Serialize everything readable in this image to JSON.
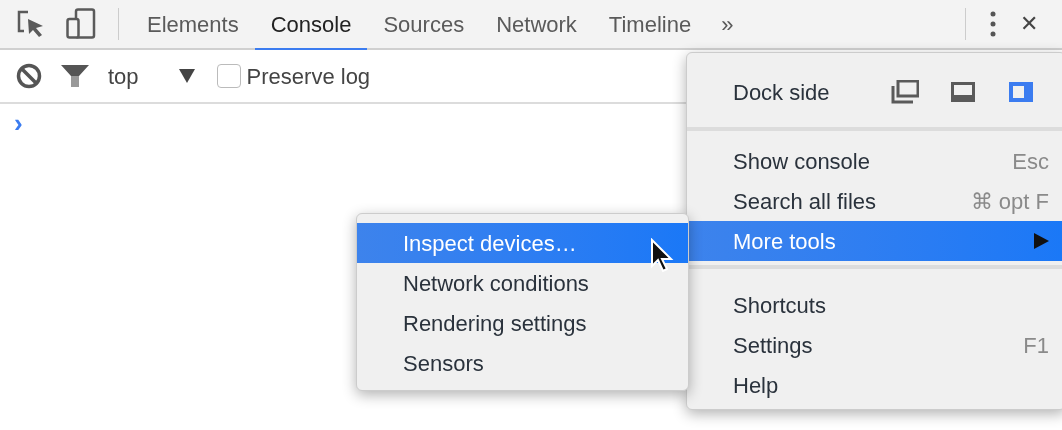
{
  "tabs": [
    {
      "label": "Elements",
      "selected": false
    },
    {
      "label": "Console",
      "selected": true
    },
    {
      "label": "Sources",
      "selected": false
    },
    {
      "label": "Network",
      "selected": false
    },
    {
      "label": "Timeline",
      "selected": false
    }
  ],
  "overflow_tabs": "»",
  "close_button": "✕",
  "console_toolbar": {
    "context": "top",
    "preserve_log": {
      "label": "Preserve log",
      "checked": false
    }
  },
  "prompt": "›",
  "main_menu": {
    "dock_side": {
      "label": "Dock side",
      "options": [
        {
          "kind": "undock",
          "selected": false
        },
        {
          "kind": "bottom",
          "selected": false
        },
        {
          "kind": "right",
          "selected": true
        }
      ]
    },
    "sections": [
      [
        {
          "label": "Show console",
          "shortcut": "Esc",
          "highlighted": false,
          "submenu": false
        },
        {
          "label": "Search all files",
          "shortcut": "⌘ opt F",
          "highlighted": false,
          "submenu": false
        },
        {
          "label": "More tools",
          "highlighted": true,
          "submenu": true
        }
      ],
      [
        {
          "label": "Shortcuts",
          "highlighted": false,
          "submenu": false
        },
        {
          "label": "Settings",
          "shortcut": "F1",
          "highlighted": false,
          "submenu": false
        },
        {
          "label": "Help",
          "highlighted": false,
          "submenu": false
        }
      ]
    ]
  },
  "submenu": [
    {
      "label": "Inspect devices…",
      "highlighted": true
    },
    {
      "label": "Network conditions",
      "highlighted": false
    },
    {
      "label": "Rendering settings",
      "highlighted": false
    },
    {
      "label": "Sensors",
      "highlighted": false
    }
  ]
}
